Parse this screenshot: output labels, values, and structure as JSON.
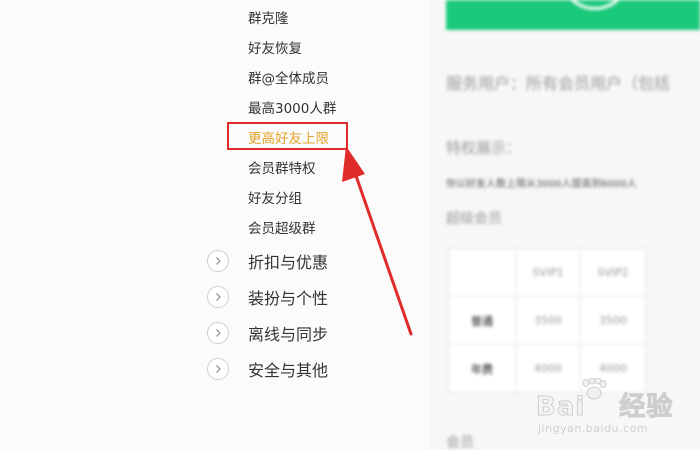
{
  "sidebar": {
    "sub_items": [
      {
        "label": "群克隆"
      },
      {
        "label": "好友恢复"
      },
      {
        "label": "群@全体成员"
      },
      {
        "label": "最高3000人群"
      },
      {
        "label": "更高好友上限"
      },
      {
        "label": "会员群特权"
      },
      {
        "label": "好友分组"
      },
      {
        "label": "会员超级群"
      }
    ],
    "active_index": 4,
    "sections": [
      {
        "label": "折扣与优惠",
        "icon": "chevron-right-icon"
      },
      {
        "label": "装扮与个性",
        "icon": "chevron-right-icon"
      },
      {
        "label": "离线与同步",
        "icon": "chevron-right-icon"
      },
      {
        "label": "安全与其他",
        "icon": "chevron-right-icon"
      }
    ]
  },
  "content": {
    "service_users": "服务用户：所有会员用户（包括",
    "privilege_title": "特权展示：",
    "privilege_desc": "你以好友人数上限从3000人提高到6000人",
    "member_label": "超级会员",
    "table": {
      "headers": [
        "",
        "SVIP1",
        "SVIP2"
      ],
      "rows": [
        [
          "普通",
          "3500",
          "3500"
        ],
        [
          "年费",
          "4000",
          "4000"
        ]
      ]
    },
    "bottom_label": "会员"
  },
  "watermark": {
    "brand_left": "Bai",
    "brand_right": "经验",
    "url": "jingyan.baidu.com"
  },
  "colors": {
    "active_item": "#e3a32a",
    "highlight_border": "#e02b2b",
    "annotation_arrow": "#e02b2b",
    "banner": "#1bc97a"
  }
}
